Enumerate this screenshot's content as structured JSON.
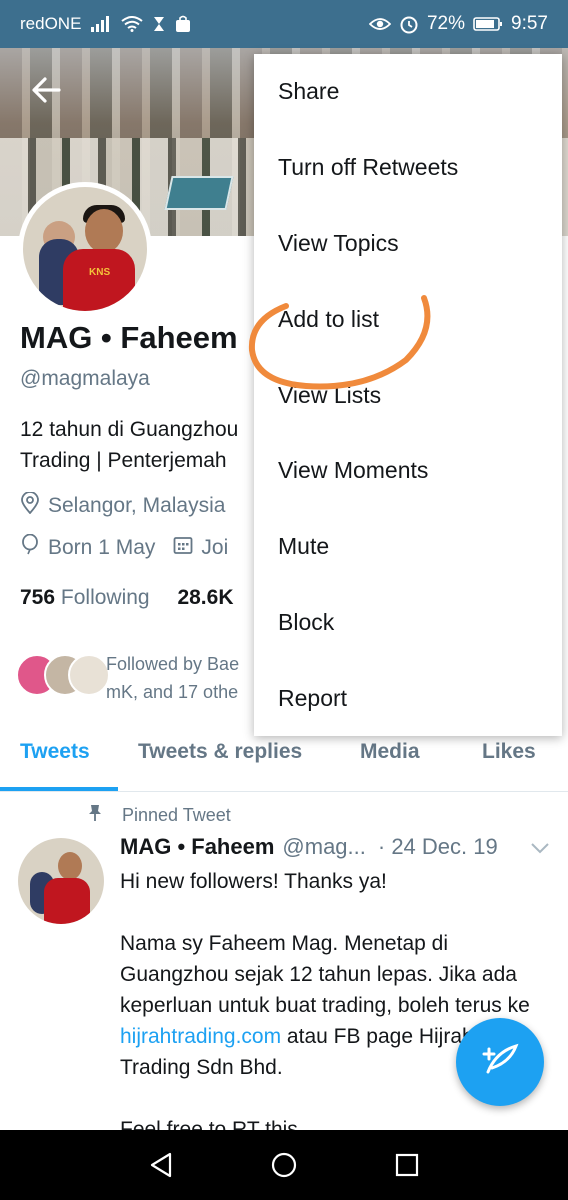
{
  "status_bar": {
    "carrier": "redONE",
    "battery": "72%",
    "time": "9:57"
  },
  "profile": {
    "name": "MAG • Faheem",
    "handle": "@magmalaya",
    "bio": "12 tahun di Guangzhou Trading | Penterjemah",
    "location": "Selangor, Malaysia",
    "birthday": "Born 1 May",
    "joined_partial": "Joi",
    "following_count": "756",
    "following_label": "Following",
    "followers_count_partial": "28.6K",
    "followed_by": "Followed by Bae mK, and 17 othe"
  },
  "tabs": [
    {
      "label": "Tweets",
      "active": true
    },
    {
      "label": "Tweets & replies",
      "active": false
    },
    {
      "label": "Media",
      "active": false
    },
    {
      "label": "Likes",
      "active": false
    }
  ],
  "tweet": {
    "pinned_label": "Pinned Tweet",
    "name": "MAG • Faheem",
    "handle": "@mag...",
    "date": "· 24 Dec. 19",
    "line1": "Hi new followers! Thanks ya!",
    "para2_start": "Nama sy Faheem Mag. Menetap di Guangzhou sejak 12 tahun lepas. Jika ada keperluan untuk buat trading, boleh terus ke ",
    "link": "hijrahtrading.com",
    "para2_end": " atau FB page Hijrah Trading Sdn Bhd.",
    "line3": "Feel free to RT this"
  },
  "menu": {
    "items": [
      "Share",
      "Turn off Retweets",
      "View Topics",
      "Add to list",
      "View Lists",
      "View Moments",
      "Mute",
      "Block",
      "Report"
    ]
  },
  "colors": {
    "accent": "#1da1f2",
    "status_bar": "#3d6f8e",
    "annotation": "#f08a3c"
  },
  "icons": {
    "back": "arrow-left-icon",
    "location": "location-pin-icon",
    "birthday": "balloon-icon",
    "calendar": "calendar-icon",
    "pin": "pin-icon",
    "chevron": "chevron-down-icon",
    "compose": "compose-tweet-icon"
  }
}
